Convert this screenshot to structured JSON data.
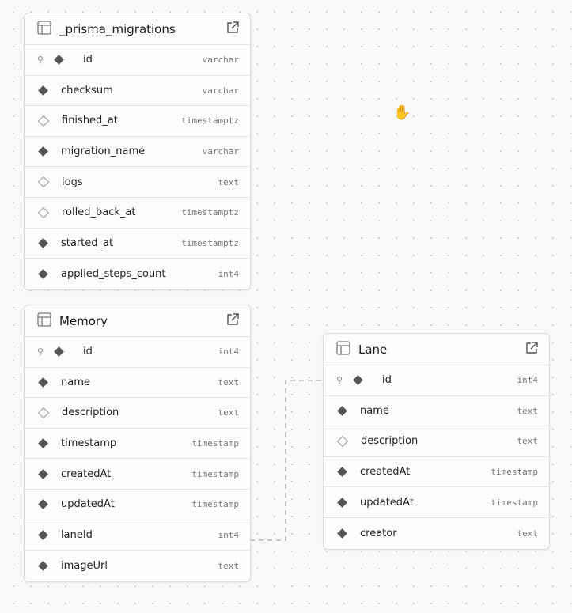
{
  "tables": [
    {
      "name": "_prisma_migrations",
      "columns": [
        {
          "name": "id",
          "type": "varchar",
          "pk": true,
          "nullable": false
        },
        {
          "name": "checksum",
          "type": "varchar",
          "nullable": false
        },
        {
          "name": "finished_at",
          "type": "timestamptz",
          "nullable": true
        },
        {
          "name": "migration_name",
          "type": "varchar",
          "nullable": false
        },
        {
          "name": "logs",
          "type": "text",
          "nullable": true
        },
        {
          "name": "rolled_back_at",
          "type": "timestamptz",
          "nullable": true
        },
        {
          "name": "started_at",
          "type": "timestamptz",
          "nullable": false
        },
        {
          "name": "applied_steps_count",
          "type": "int4",
          "nullable": false
        }
      ]
    },
    {
      "name": "Memory",
      "columns": [
        {
          "name": "id",
          "type": "int4",
          "pk": true,
          "nullable": false
        },
        {
          "name": "name",
          "type": "text",
          "nullable": false
        },
        {
          "name": "description",
          "type": "text",
          "nullable": true
        },
        {
          "name": "timestamp",
          "type": "timestamp",
          "nullable": false
        },
        {
          "name": "createdAt",
          "type": "timestamp",
          "nullable": false
        },
        {
          "name": "updatedAt",
          "type": "timestamp",
          "nullable": false
        },
        {
          "name": "laneId",
          "type": "int4",
          "nullable": false
        },
        {
          "name": "imageUrl",
          "type": "text",
          "nullable": false
        }
      ]
    },
    {
      "name": "Lane",
      "columns": [
        {
          "name": "id",
          "type": "int4",
          "pk": true,
          "nullable": false
        },
        {
          "name": "name",
          "type": "text",
          "nullable": false
        },
        {
          "name": "description",
          "type": "text",
          "nullable": true
        },
        {
          "name": "createdAt",
          "type": "timestamp",
          "nullable": false
        },
        {
          "name": "updatedAt",
          "type": "timestamp",
          "nullable": false
        },
        {
          "name": "creator",
          "type": "text",
          "nullable": false
        }
      ]
    }
  ],
  "relations": [
    {
      "from": "Memory.laneId",
      "to": "Lane.id"
    }
  ]
}
